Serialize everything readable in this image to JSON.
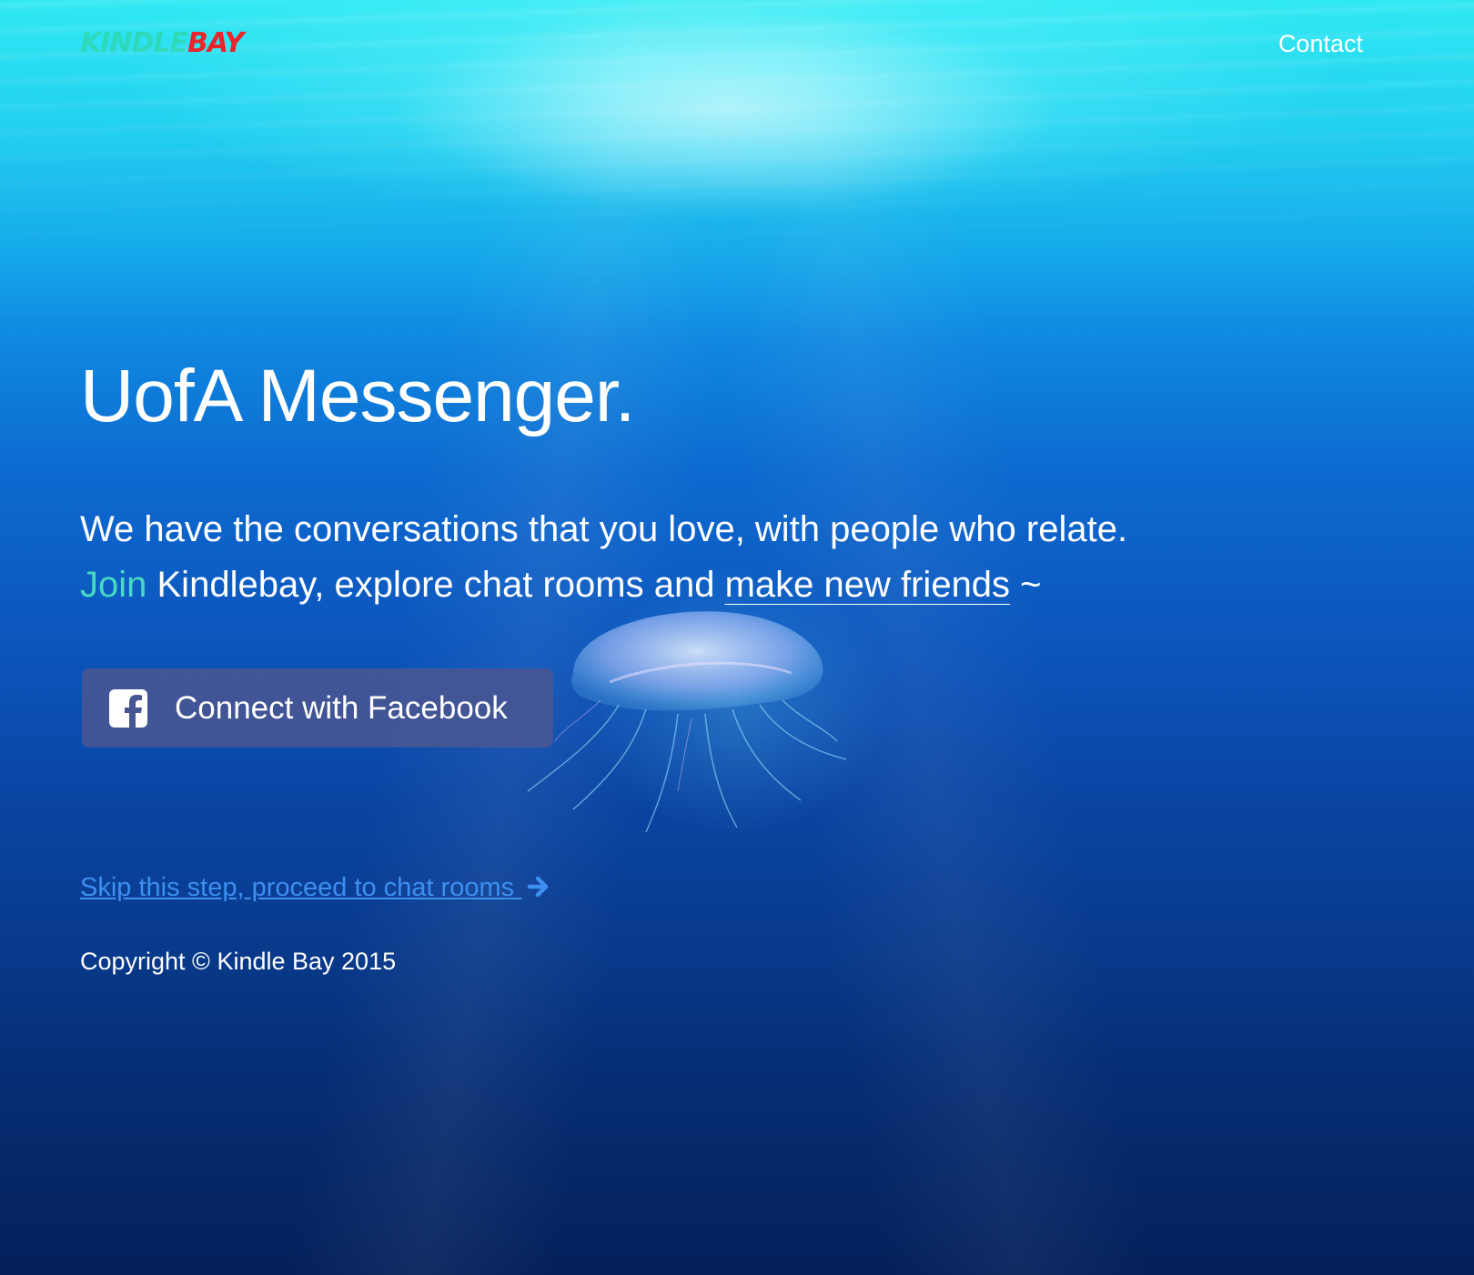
{
  "header": {
    "logo": {
      "part1": "KINDLE",
      "part2": "BAY"
    },
    "nav_contact": "Contact"
  },
  "hero": {
    "title": "UofA Messenger.",
    "tagline_line1": "We have the conversations that you love, with people who relate.",
    "tagline_join": "Join",
    "tagline_middle": " Kindlebay, explore chat rooms and ",
    "tagline_friends": "make new friends",
    "tagline_end": " ~"
  },
  "actions": {
    "facebook_button": "Connect with Facebook",
    "facebook_icon": "facebook-square-icon",
    "skip_link": "Skip this step, proceed to chat rooms",
    "skip_icon": "arrow-right-icon"
  },
  "footer": {
    "copyright": "Copyright © Kindle Bay 2015"
  },
  "colors": {
    "join_accent": "#48d8c4",
    "logo_kindle": "#2fd6a8",
    "logo_bay": "#e8262c",
    "facebook_button": "#465694",
    "skip_link": "#3d8ff0"
  }
}
